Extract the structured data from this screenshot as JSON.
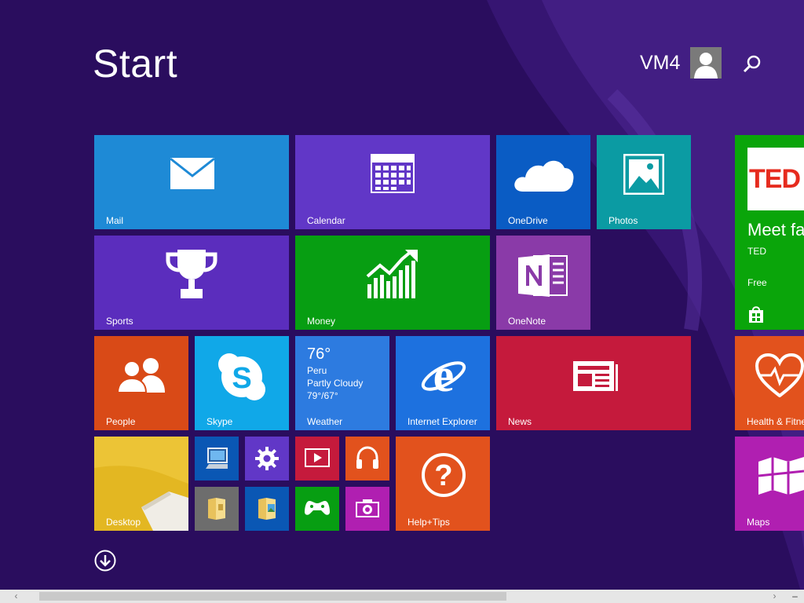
{
  "start": {
    "title": "Start"
  },
  "user": {
    "name": "VM4"
  },
  "colors": {
    "background": "#2a0d5e",
    "mail": "#1e8ad6",
    "calendar": "#6137c7",
    "onedrive": "#0a5cc4",
    "photos": "#0b9ba3",
    "sports": "#5b2dbd",
    "money": "#079e12",
    "onenote": "#8a3aa8",
    "people": "#d94a17",
    "skype": "#10a8e8",
    "weather": "#2d7be0",
    "ie": "#1d71df",
    "news": "#c51a3c",
    "help": "#e2521d",
    "ted": "#0aa50a",
    "health": "#e2521d",
    "maps": "#b01fb1"
  },
  "tiles": {
    "mail": {
      "label": "Mail"
    },
    "calendar": {
      "label": "Calendar"
    },
    "onedrive": {
      "label": "OneDrive"
    },
    "photos": {
      "label": "Photos"
    },
    "sports": {
      "label": "Sports"
    },
    "money": {
      "label": "Money"
    },
    "onenote": {
      "label": "OneNote"
    },
    "people": {
      "label": "People"
    },
    "skype": {
      "label": "Skype"
    },
    "weather": {
      "label": "Weather",
      "temp": "76°",
      "city": "Peru",
      "condition": "Partly Cloudy",
      "range": "79°/67°"
    },
    "ie": {
      "label": "Internet Explorer"
    },
    "news": {
      "label": "News"
    },
    "desktop": {
      "label": "Desktop"
    },
    "help": {
      "label": "Help+Tips"
    },
    "ted": {
      "logo": "TED",
      "headline": "Meet fas",
      "publisher": "TED",
      "price": "Free"
    },
    "health": {
      "label": "Health & Fitne"
    },
    "maps": {
      "label": "Maps"
    }
  },
  "small_tiles": [
    "this-pc",
    "pc-settings",
    "video",
    "music",
    "file-explorer",
    "windows-photo-viewer",
    "xbox-games",
    "camera"
  ],
  "scrollbar": {
    "position": 0.03,
    "visible_fraction": 0.63
  }
}
